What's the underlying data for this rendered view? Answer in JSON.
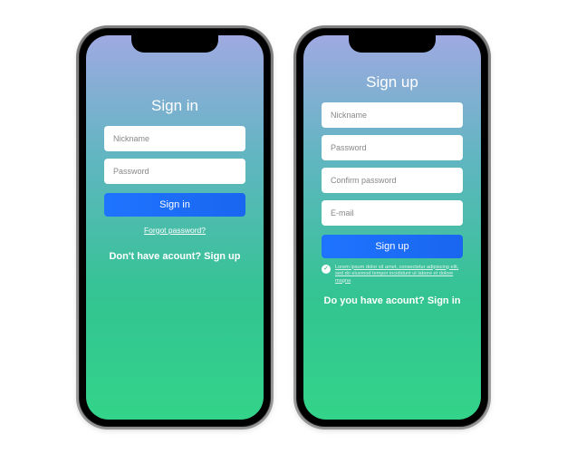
{
  "signin": {
    "title": "Sign in",
    "nickname_placeholder": "Nickname",
    "password_placeholder": "Password",
    "button_label": "Sign in",
    "forgot_label": "Forgot password?",
    "switch_prompt": "Don't have acount? ",
    "switch_action": "Sign up"
  },
  "signup": {
    "title": "Sign up",
    "nickname_placeholder": "Nickname",
    "password_placeholder": "Password",
    "confirm_placeholder": "Confirm password",
    "email_placeholder": "E-mail",
    "button_label": "Sign up",
    "terms_text": "Lorem ipsum dolor sit amet, consectetur adipiscing elit, sed do eiusmod tempor incididunt ut labore et dolore magna",
    "switch_prompt": "Do you have acount? ",
    "switch_action": "Sign in"
  },
  "colors": {
    "button": "#1e74ff",
    "gradient_top": "#9fa9e2",
    "gradient_bottom": "#33d48a"
  }
}
